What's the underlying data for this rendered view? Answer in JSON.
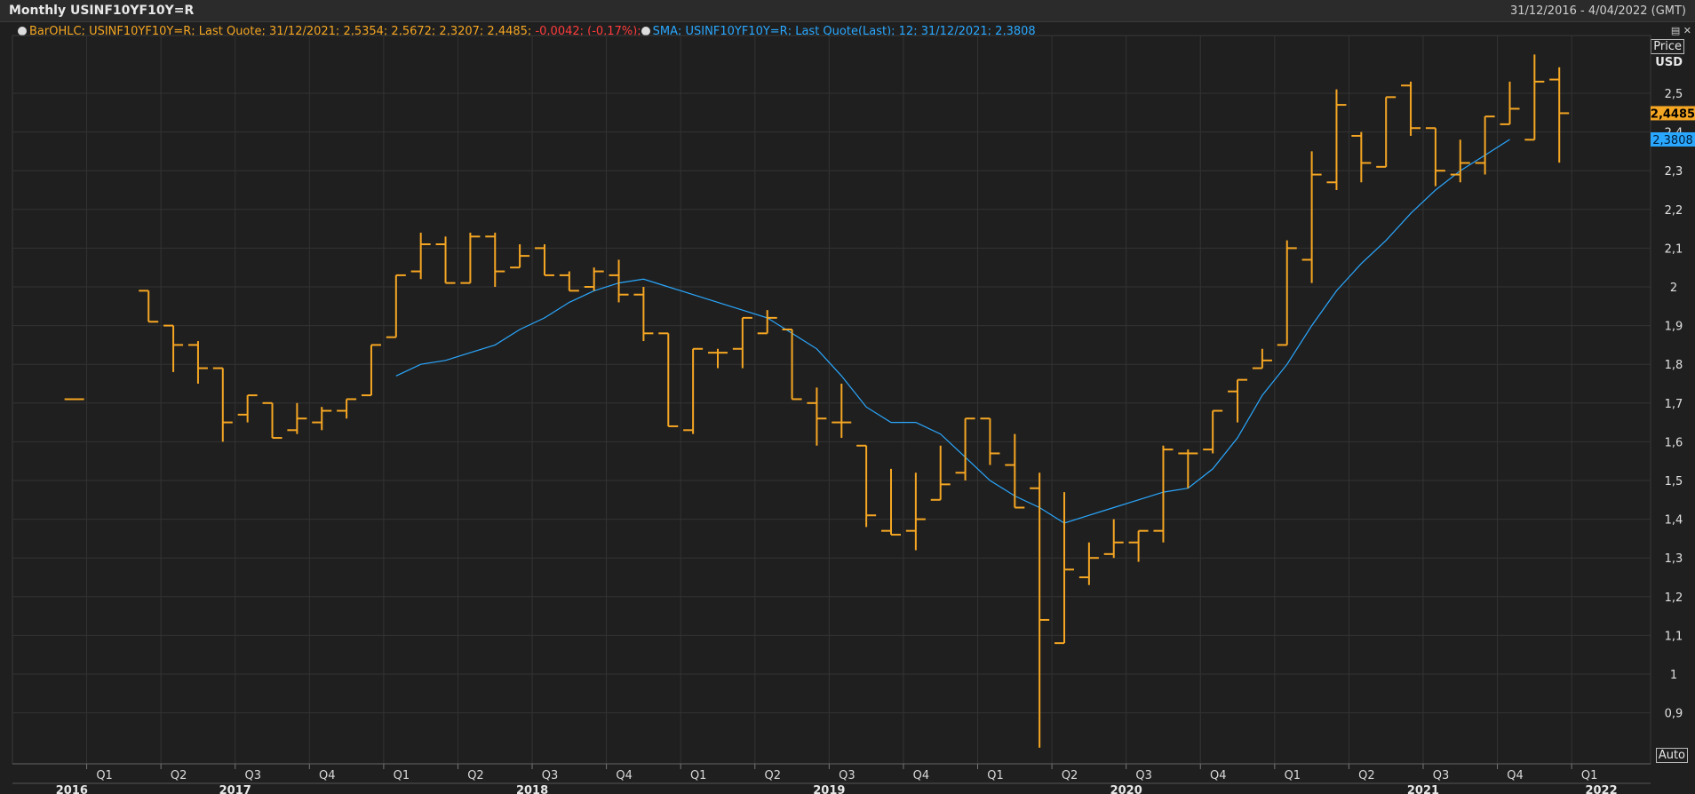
{
  "header": {
    "title": "Monthly USINF10YF10Y=R",
    "date_range": "31/12/2016 - 4/04/2022 (GMT)"
  },
  "legend": {
    "bar_label": "BarOHLC; USINF10YF10Y=R; Last Quote; 31/12/2021; 2,5354; 2,5672; 2,3207; 2,4485;",
    "bar_change": "-0,0042; (-0,17%);",
    "sma_label": "SMA; USINF10YF10Y=R; Last Quote(Last);  12; 31/12/2021; 2,3808"
  },
  "axis_labels": {
    "price": "Price",
    "currency": "USD",
    "auto": "Auto"
  },
  "colors": {
    "bars": "#f5a623",
    "sma": "#2aa8ff",
    "negative": "#ff3b3b",
    "background": "#1f1f1f",
    "grid": "#333333"
  },
  "chart_data": {
    "type": "bar",
    "subtype": "ohlc",
    "ylim": [
      0.8,
      2.6
    ],
    "y_ticks": [
      0.9,
      1.0,
      1.1,
      1.2,
      1.3,
      1.4,
      1.5,
      1.6,
      1.7,
      1.8,
      1.9,
      2.0,
      2.1,
      2.2,
      2.3,
      2.4,
      2.5
    ],
    "y_tick_labels": [
      "0,9",
      "1",
      "1,1",
      "1,2",
      "1,3",
      "1,4",
      "1,5",
      "1,6",
      "1,7",
      "1,8",
      "1,9",
      "2",
      "2,1",
      "2,2",
      "2,3",
      "2,4",
      "2,5"
    ],
    "x_quarter_labels": [
      {
        "label": "Q1",
        "t": 2017.0
      },
      {
        "label": "Q2",
        "t": 2017.25
      },
      {
        "label": "Q3",
        "t": 2017.5
      },
      {
        "label": "Q4",
        "t": 2017.75
      },
      {
        "label": "Q1",
        "t": 2018.0
      },
      {
        "label": "Q2",
        "t": 2018.25
      },
      {
        "label": "Q3",
        "t": 2018.5
      },
      {
        "label": "Q4",
        "t": 2018.75
      },
      {
        "label": "Q1",
        "t": 2019.0
      },
      {
        "label": "Q2",
        "t": 2019.25
      },
      {
        "label": "Q3",
        "t": 2019.5
      },
      {
        "label": "Q4",
        "t": 2019.75
      },
      {
        "label": "Q1",
        "t": 2020.0
      },
      {
        "label": "Q2",
        "t": 2020.25
      },
      {
        "label": "Q3",
        "t": 2020.5
      },
      {
        "label": "Q4",
        "t": 2020.75
      },
      {
        "label": "Q1",
        "t": 2021.0
      },
      {
        "label": "Q2",
        "t": 2021.25
      },
      {
        "label": "Q3",
        "t": 2021.5
      },
      {
        "label": "Q4",
        "t": 2021.75
      },
      {
        "label": "Q1",
        "t": 2022.0
      }
    ],
    "x_year_labels": [
      {
        "label": "2016",
        "t": 2016.95
      },
      {
        "label": "2017",
        "t": 2017.5
      },
      {
        "label": "2018",
        "t": 2018.5
      },
      {
        "label": "2019",
        "t": 2019.5
      },
      {
        "label": "2020",
        "t": 2020.5
      },
      {
        "label": "2021",
        "t": 2021.5
      },
      {
        "label": "2022",
        "t": 2022.1
      }
    ],
    "last_close_label": "2,4485",
    "last_sma_label": "2,3808",
    "last_close": 2.4485,
    "last_sma": 2.3808,
    "series": [
      {
        "name": "BarOHLC",
        "ohlc": [
          [
            "2016-12",
            1.71,
            1.71,
            1.71,
            1.71
          ],
          [
            "2017-03",
            1.99,
            1.99,
            1.91,
            1.91
          ],
          [
            "2017-04",
            1.9,
            1.9,
            1.78,
            1.85
          ],
          [
            "2017-05",
            1.85,
            1.86,
            1.75,
            1.79
          ],
          [
            "2017-06",
            1.79,
            1.79,
            1.6,
            1.65
          ],
          [
            "2017-07",
            1.67,
            1.72,
            1.65,
            1.72
          ],
          [
            "2017-08",
            1.7,
            1.7,
            1.61,
            1.61
          ],
          [
            "2017-09",
            1.63,
            1.7,
            1.62,
            1.66
          ],
          [
            "2017-10",
            1.65,
            1.69,
            1.63,
            1.68
          ],
          [
            "2017-11",
            1.68,
            1.71,
            1.66,
            1.71
          ],
          [
            "2017-12",
            1.72,
            1.85,
            1.72,
            1.85
          ],
          [
            "2018-01",
            1.87,
            2.03,
            1.87,
            2.03
          ],
          [
            "2018-02",
            2.04,
            2.14,
            2.02,
            2.11
          ],
          [
            "2018-03",
            2.11,
            2.13,
            2.01,
            2.01
          ],
          [
            "2018-04",
            2.01,
            2.14,
            2.01,
            2.13
          ],
          [
            "2018-05",
            2.13,
            2.14,
            2.0,
            2.04
          ],
          [
            "2018-06",
            2.05,
            2.11,
            2.05,
            2.08
          ],
          [
            "2018-07",
            2.1,
            2.11,
            2.03,
            2.03
          ],
          [
            "2018-08",
            2.03,
            2.04,
            1.99,
            1.99
          ],
          [
            "2018-09",
            2.0,
            2.05,
            1.99,
            2.04
          ],
          [
            "2018-10",
            2.03,
            2.07,
            1.96,
            1.98
          ],
          [
            "2018-11",
            1.98,
            2.0,
            1.86,
            1.88
          ],
          [
            "2018-12",
            1.88,
            1.88,
            1.64,
            1.64
          ],
          [
            "2019-01",
            1.63,
            1.84,
            1.62,
            1.84
          ],
          [
            "2019-02",
            1.83,
            1.84,
            1.79,
            1.83
          ],
          [
            "2019-03",
            1.84,
            1.92,
            1.79,
            1.92
          ],
          [
            "2019-04",
            1.88,
            1.94,
            1.88,
            1.92
          ],
          [
            "2019-05",
            1.89,
            1.89,
            1.71,
            1.71
          ],
          [
            "2019-06",
            1.7,
            1.74,
            1.59,
            1.66
          ],
          [
            "2019-07",
            1.65,
            1.75,
            1.61,
            1.65
          ],
          [
            "2019-08",
            1.59,
            1.59,
            1.38,
            1.41
          ],
          [
            "2019-09",
            1.37,
            1.53,
            1.36,
            1.36
          ],
          [
            "2019-10",
            1.37,
            1.52,
            1.32,
            1.4
          ],
          [
            "2019-11",
            1.45,
            1.59,
            1.45,
            1.49
          ],
          [
            "2019-12",
            1.52,
            1.66,
            1.5,
            1.66
          ],
          [
            "2020-01",
            1.66,
            1.66,
            1.54,
            1.57
          ],
          [
            "2020-02",
            1.54,
            1.62,
            1.43,
            1.43
          ],
          [
            "2020-03",
            1.48,
            1.52,
            0.81,
            1.14
          ],
          [
            "2020-04",
            1.08,
            1.47,
            1.08,
            1.27
          ],
          [
            "2020-05",
            1.25,
            1.34,
            1.23,
            1.3
          ],
          [
            "2020-06",
            1.31,
            1.4,
            1.3,
            1.34
          ],
          [
            "2020-07",
            1.34,
            1.37,
            1.29,
            1.37
          ],
          [
            "2020-08",
            1.37,
            1.59,
            1.34,
            1.58
          ],
          [
            "2020-09",
            1.57,
            1.58,
            1.48,
            1.57
          ],
          [
            "2020-10",
            1.58,
            1.68,
            1.57,
            1.68
          ],
          [
            "2020-11",
            1.73,
            1.76,
            1.65,
            1.76
          ],
          [
            "2020-12",
            1.79,
            1.84,
            1.79,
            1.81
          ],
          [
            "2021-01",
            1.85,
            2.12,
            1.85,
            2.1
          ],
          [
            "2021-02",
            2.07,
            2.35,
            2.01,
            2.29
          ],
          [
            "2021-03",
            2.27,
            2.51,
            2.25,
            2.47
          ],
          [
            "2021-04",
            2.39,
            2.4,
            2.27,
            2.32
          ],
          [
            "2021-05",
            2.31,
            2.49,
            2.31,
            2.49
          ],
          [
            "2021-06",
            2.52,
            2.53,
            2.39,
            2.41
          ],
          [
            "2021-07",
            2.41,
            2.41,
            2.26,
            2.3
          ],
          [
            "2021-08",
            2.29,
            2.38,
            2.27,
            2.32
          ],
          [
            "2021-09",
            2.32,
            2.44,
            2.29,
            2.44
          ],
          [
            "2021-10",
            2.42,
            2.53,
            2.42,
            2.46
          ],
          [
            "2021-11",
            2.38,
            2.6,
            2.38,
            2.53
          ],
          [
            "2021-12",
            2.5354,
            2.5672,
            2.3207,
            2.4485
          ]
        ]
      },
      {
        "name": "SMA",
        "period": 12,
        "points": [
          [
            "2018-01",
            1.77
          ],
          [
            "2018-02",
            1.8
          ],
          [
            "2018-03",
            1.81
          ],
          [
            "2018-04",
            1.83
          ],
          [
            "2018-05",
            1.85
          ],
          [
            "2018-06",
            1.89
          ],
          [
            "2018-07",
            1.92
          ],
          [
            "2018-08",
            1.96
          ],
          [
            "2018-09",
            1.99
          ],
          [
            "2018-10",
            2.01
          ],
          [
            "2018-11",
            2.02
          ],
          [
            "2018-12",
            2.0
          ],
          [
            "2019-01",
            1.98
          ],
          [
            "2019-02",
            1.96
          ],
          [
            "2019-03",
            1.94
          ],
          [
            "2019-04",
            1.92
          ],
          [
            "2019-05",
            1.88
          ],
          [
            "2019-06",
            1.84
          ],
          [
            "2019-07",
            1.77
          ],
          [
            "2019-08",
            1.69
          ],
          [
            "2019-09",
            1.65
          ],
          [
            "2019-10",
            1.65
          ],
          [
            "2019-11",
            1.62
          ],
          [
            "2019-12",
            1.56
          ],
          [
            "2020-01",
            1.5
          ],
          [
            "2020-02",
            1.46
          ],
          [
            "2020-03",
            1.43
          ],
          [
            "2020-04",
            1.39
          ],
          [
            "2020-05",
            1.41
          ],
          [
            "2020-06",
            1.43
          ],
          [
            "2020-07",
            1.45
          ],
          [
            "2020-08",
            1.47
          ],
          [
            "2020-09",
            1.48
          ],
          [
            "2020-10",
            1.53
          ],
          [
            "2020-11",
            1.61
          ],
          [
            "2020-12",
            1.72
          ],
          [
            "2021-01",
            1.8
          ],
          [
            "2021-02",
            1.9
          ],
          [
            "2021-03",
            1.99
          ],
          [
            "2021-04",
            2.06
          ],
          [
            "2021-05",
            2.12
          ],
          [
            "2021-06",
            2.19
          ],
          [
            "2021-07",
            2.25
          ],
          [
            "2021-08",
            2.3
          ],
          [
            "2021-09",
            2.34
          ],
          [
            "2021-10",
            2.3808
          ]
        ]
      }
    ]
  }
}
